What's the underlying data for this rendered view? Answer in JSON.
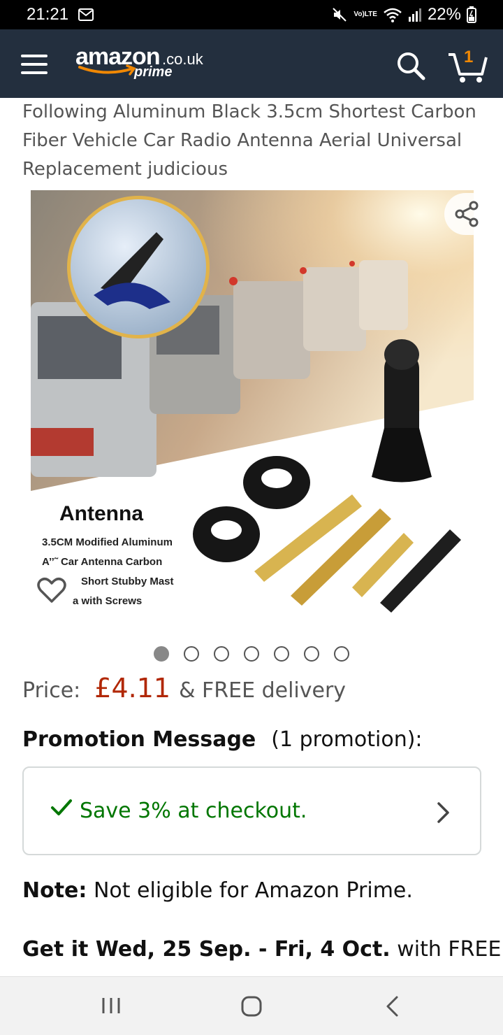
{
  "status_bar": {
    "time": "21:21",
    "volte": "Vo)",
    "lte": "LTE",
    "battery": "22%"
  },
  "header": {
    "logo_main": "amazon",
    "logo_tld": ".co.uk",
    "logo_prime": "prime",
    "cart_count": "1",
    "accent_color": "#f08804",
    "background_color": "#232f3e"
  },
  "product": {
    "title": "Following Aluminum Black 3.5cm Shortest Carbon Fiber Vehicle Car Radio Antenna Aerial Universal Replacement judicious",
    "image_caption_title": "Antenna",
    "image_caption_lines": [
      "3.5CM Modified Aluminum",
      "A’’˜ Car Antenna Carbon",
      "Short Stubby Mast",
      "a with Screws"
    ],
    "carousel_total": 7,
    "carousel_active": 0
  },
  "price": {
    "label": "Price:",
    "value": "£4.11",
    "delivery": "& FREE delivery",
    "color": "#b12704"
  },
  "promotion": {
    "heading": "Promotion Message",
    "count": "(1 promotion):",
    "text": "Save 3% at checkout.",
    "color": "#007600"
  },
  "note": {
    "label": "Note:",
    "text": " Not eligible for Amazon Prime."
  },
  "delivery": {
    "prefix": "Get it Wed, 25 Sep. - Fri, 4 Oct.",
    "suffix": " with FREE"
  },
  "icons": {
    "menu": "hamburger-menu-icon",
    "search": "search-icon",
    "cart": "cart-icon",
    "share": "share-icon",
    "wishlist": "heart-icon",
    "check": "check-icon",
    "chevron": "chevron-right-icon"
  }
}
